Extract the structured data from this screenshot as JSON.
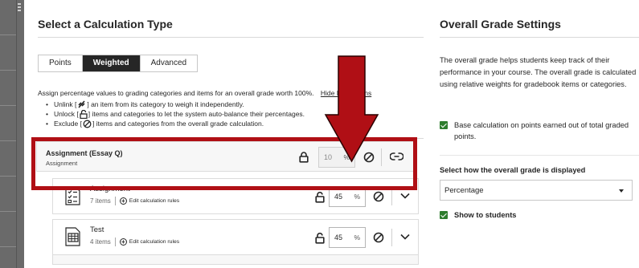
{
  "calculation": {
    "title": "Select a Calculation Type",
    "tabs": [
      {
        "label": "Points",
        "active": false
      },
      {
        "label": "Weighted",
        "active": true
      },
      {
        "label": "Advanced",
        "active": false
      }
    ],
    "instructions": {
      "intro": "Assign percentage values to grading categories and items for an overall grade worth 100%.",
      "hide_link": "Hide Instructions",
      "bullets": [
        {
          "before": "Unlink [",
          "icon": "unlink-icon",
          "after": "] an item from its category to weigh it independently."
        },
        {
          "before": "Unlock [",
          "icon": "unlock-icon",
          "after": "] items and categories to let the system auto-balance their percentages."
        },
        {
          "before": "Exclude [",
          "icon": "exclude-icon",
          "after": "] items and categories from the overall grade calculation."
        }
      ]
    },
    "items": [
      {
        "name": "Assignment (Essay Q)",
        "subtitle": "Assignment",
        "percent": "10",
        "unit": "%",
        "locked": true,
        "row_icon": "link-icon"
      },
      {
        "name": "Assignment",
        "count": "7 items",
        "edit_label": "Edit calculation rules",
        "percent": "45",
        "unit": "%",
        "locked": false,
        "row_icon": "chevron-down-icon",
        "category_icon": "checklist-icon"
      },
      {
        "name": "Test",
        "count": "4 items",
        "edit_label": "Edit calculation rules",
        "percent": "45",
        "unit": "%",
        "locked": false,
        "row_icon": "chevron-down-icon",
        "category_icon": "test-grid-icon"
      }
    ]
  },
  "overall": {
    "title": "Overall Grade Settings",
    "description": "The overall grade helps students keep track of their performance in your course. The overall grade is calculated using relative weights for gradebook items or categories.",
    "base_points": {
      "label": "Base calculation on points earned out of total graded points.",
      "checked": true
    },
    "display_label": "Select how the overall grade is displayed",
    "display_value": "Percentage",
    "show_students": {
      "label": "Show to students",
      "checked": true
    }
  },
  "annotation": {
    "color": "#b00f15"
  }
}
